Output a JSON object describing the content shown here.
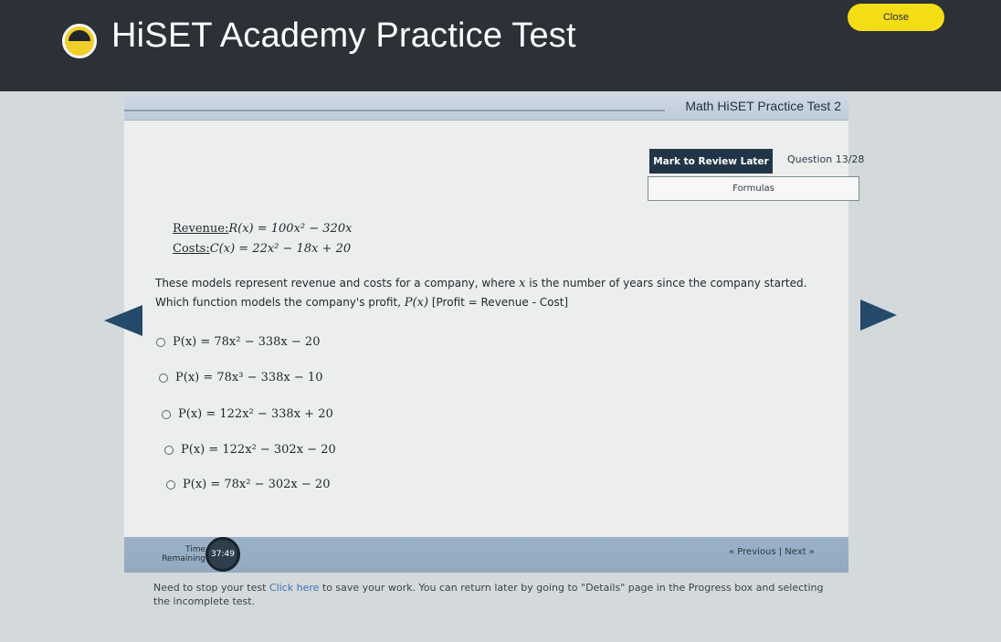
{
  "header": {
    "app_title": "HiSET Academy Practice Test",
    "close_label": "Close",
    "logo_icon": "hiset-logo-icon"
  },
  "test": {
    "title": "Math HiSET Practice Test 2",
    "review_label": "Mark to Review Later",
    "question_counter": "Question 13/28",
    "formulas_label": "Formulas"
  },
  "question": {
    "revenue_label": "Revenue:",
    "revenue_formula": "R(x) = 100x² − 320x",
    "costs_label": "Costs:",
    "costs_formula": "C(x) = 22x² − 18x + 20",
    "stem_part1": "These models represent revenue and costs for a company, where ",
    "stem_var": "x",
    "stem_part2": " is the number of years since the company started. Which function models the company's profit, ",
    "stem_func": "P(x)",
    "stem_part3": " [Profit = Revenue - Cost]",
    "choices": [
      "P(x) = 78x² − 338x − 20",
      "P(x) = 78x³ − 338x − 10",
      "P(x) = 122x² − 338x + 20",
      "P(x) = 122x² − 302x − 20",
      "P(x) = 78x² − 302x − 20"
    ]
  },
  "footer": {
    "time_label_line1": "Time",
    "time_label_line2": "Remaining",
    "time_value": "37:49",
    "previous_label": "« Previous",
    "separator": " | ",
    "next_label": "Next »"
  },
  "notice": {
    "part1": "Need to stop your test ",
    "link": "Click here",
    "part2": " to save your work. You can return later by going to \"Details\" page in the Progress box and selecting the incomplete test."
  },
  "colors": {
    "top_bar": "#2b3137",
    "close_button": "#f5dd16",
    "review_button": "#223548",
    "nav_arrow": "#244a6b",
    "footer_bar": "#9bb2c8",
    "link": "#3e74b8"
  }
}
